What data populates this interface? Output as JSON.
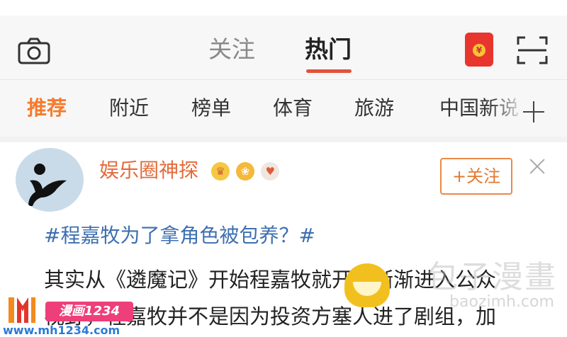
{
  "header": {
    "tabs": [
      {
        "label": "关注",
        "active": false
      },
      {
        "label": "热门",
        "active": true
      }
    ],
    "icons": [
      "camera-icon",
      "red-packet-icon",
      "scan-icon"
    ],
    "red_packet_symbol": "¥",
    "accent_color": "#e2523a"
  },
  "channels": {
    "items": [
      "推荐",
      "附近",
      "榜单",
      "体育",
      "旅游",
      "中国新说"
    ],
    "active_index": 0,
    "active_color": "#f77a2d"
  },
  "post": {
    "author": "娱乐圈神探",
    "badges": [
      "crown-badge",
      "vip-badge",
      "fans-badge"
    ],
    "follow_label": "+关注",
    "topic": "#程嘉牧为了拿角色被包养？#",
    "lines": [
      "其实从《遴魔记》开始程嘉牧就开始渐渐进入公众",
      "视野，程嘉牧并不是因为投资方塞人进了剧组，加"
    ]
  },
  "watermarks": {
    "right_big": "包子漫畫",
    "right_small": "baozimh.com",
    "left_banner": "漫画1234",
    "left_url": "www.mh1234.com"
  }
}
